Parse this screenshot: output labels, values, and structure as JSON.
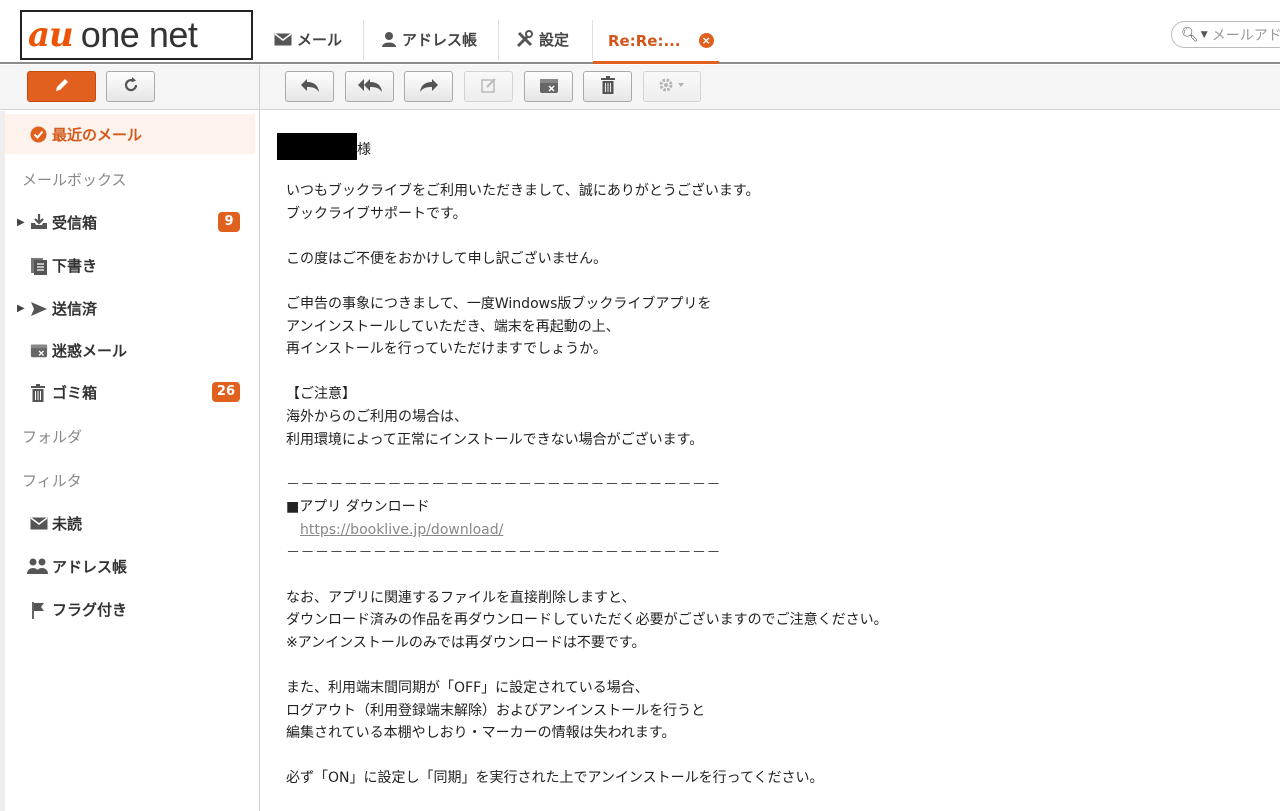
{
  "header": {
    "logo_au": "au",
    "logo_text": "one net",
    "tabs": [
      {
        "label": "メール",
        "icon": "envelope-icon"
      },
      {
        "label": "アドレス帳",
        "icon": "person-icon"
      },
      {
        "label": "設定",
        "icon": "tools-icon"
      }
    ],
    "active_tab": {
      "label": "Re:Re:...",
      "close_icon": "close-icon"
    },
    "search": {
      "placeholder": "メールアド"
    }
  },
  "toolbar": {
    "buttons": [
      "compose-pencil-icon",
      "refresh-icon",
      "reply-icon",
      "reply-all-icon",
      "forward-icon",
      "edit-icon",
      "spam-box-icon",
      "trash-icon",
      "gear-dropdown-icon"
    ],
    "accent": "#e0601e"
  },
  "sidebar": {
    "recent": "最近のメール",
    "mailbox_heading": "メールボックス",
    "items": [
      {
        "label": "受信箱",
        "badge": "9"
      },
      {
        "label": "下書き"
      },
      {
        "label": "送信済"
      },
      {
        "label": "迷惑メール"
      },
      {
        "label": "ゴミ箱",
        "badge": "26"
      }
    ],
    "folder_heading": "フォルダ",
    "filter_heading": "フィルタ",
    "filters": [
      {
        "label": "未読"
      },
      {
        "label": "アドレス帳"
      },
      {
        "label": "フラグ付き"
      }
    ]
  },
  "message": {
    "honorific": "様",
    "lines": [
      "いつもブックライブをご利用いただきまして、誠にありがとうございます。",
      "ブックライブサポートです。",
      "",
      "この度はご不便をおかけして申し訳ございません。",
      "",
      "ご申告の事象につきまして、一度Windows版ブックライブアプリを",
      "アンインストールしていただき、端末を再起動の上、",
      "再インストールを行っていただけますでしょうか。",
      "",
      "【ご注意】",
      "海外からのご利用の場合は、",
      "利用環境によって正常にインストールできない場合がございます。",
      "",
      "－－－－－－－－－－－－－－－－－－－－－－－－－－－－－－",
      "■アプリ ダウンロード",
      "https://booklive.jp/download/",
      "－－－－－－－－－－－－－－－－－－－－－－－－－－－－－－",
      "",
      "なお、アプリに関連するファイルを直接削除しますと、",
      "ダウンロード済みの作品を再ダウンロードしていただく必要がございますのでご注意ください。",
      "※アンインストールのみでは再ダウンロードは不要です。",
      "",
      "また、利用端末間同期が「OFF」に設定されている場合、",
      "ログアウト（利用登録端末解除）およびアンインストールを行うと",
      "編集されている本棚やしおり・マーカーの情報は失われます。",
      "",
      "必ず「ON」に設定し「同期」を実行された上でアンインストールを行ってください。"
    ]
  }
}
